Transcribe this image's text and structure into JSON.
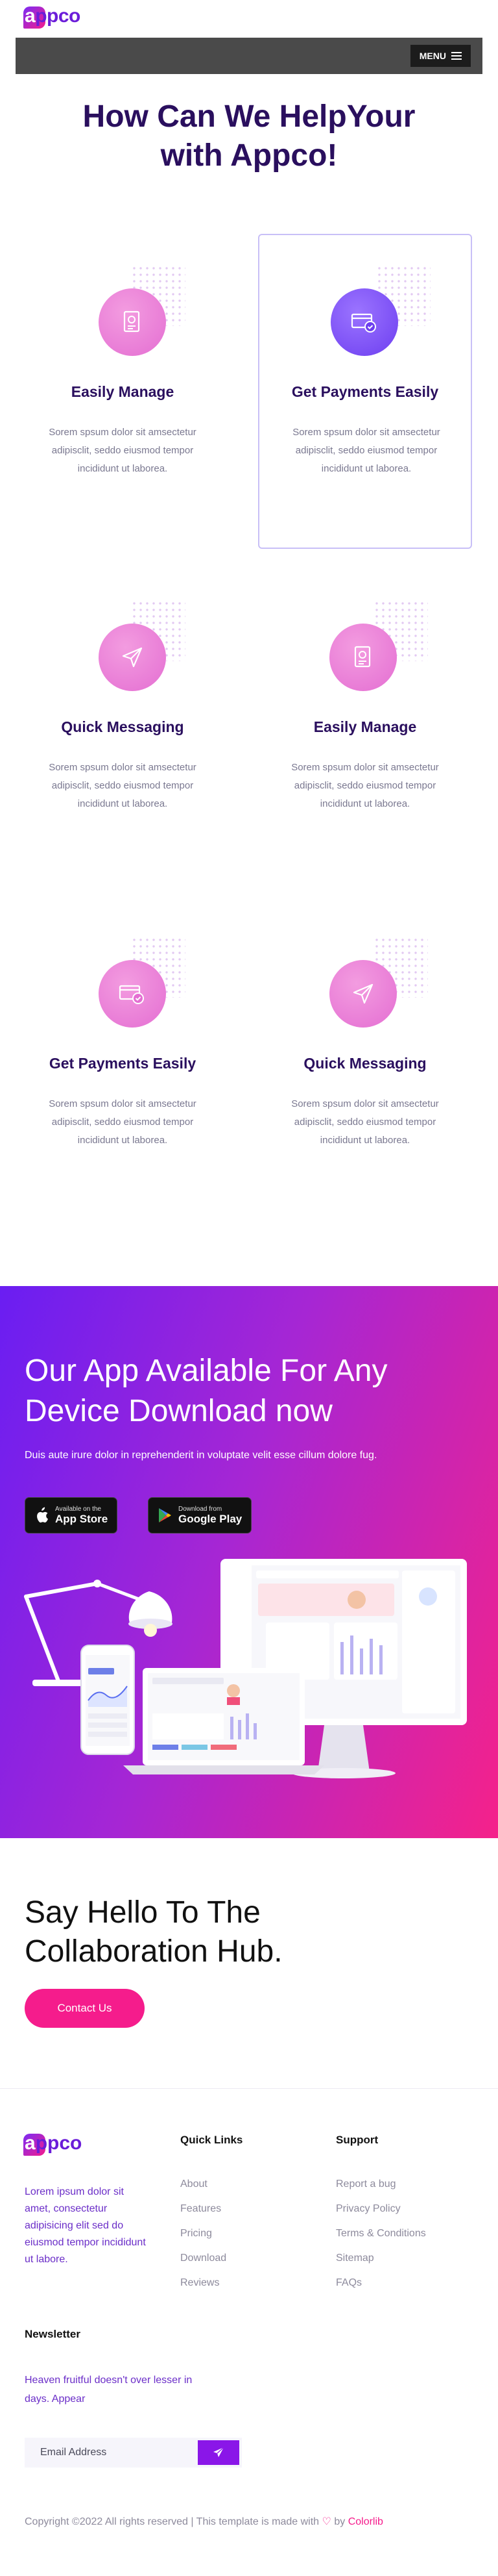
{
  "header": {
    "logo_first": "a",
    "logo_rest": "ppco",
    "menu_label": "MENU"
  },
  "help": {
    "title_line1": "How Can We HelpYour",
    "title_line2": "with Appco!"
  },
  "features": [
    {
      "title": "Easily Manage",
      "text": "Sorem spsum dolor sit amsectetur adipisclit, seddo eiusmod tempor incididunt ut laborea.",
      "icon": "manage-icon"
    },
    {
      "title": "Get Payments Easily",
      "text": "Sorem spsum dolor sit amsectetur adipisclit, seddo eiusmod tempor incididunt ut laborea.",
      "icon": "payment-icon"
    },
    {
      "title": "Quick Messaging",
      "text": "Sorem spsum dolor sit amsectetur adipisclit, seddo eiusmod tempor incididunt ut laborea.",
      "icon": "paper-plane-icon"
    },
    {
      "title": "Easily Manage",
      "text": "Sorem spsum dolor sit amsectetur adipisclit, seddo eiusmod tempor incididunt ut laborea.",
      "icon": "manage-icon"
    },
    {
      "title": "Get Payments Easily",
      "text": "Sorem spsum dolor sit amsectetur adipisclit, seddo eiusmod tempor incididunt ut laborea.",
      "icon": "payment-icon"
    },
    {
      "title": "Quick Messaging",
      "text": "Sorem spsum dolor sit amsectetur adipisclit, seddo eiusmod tempor incididunt ut laborea.",
      "icon": "paper-plane-icon"
    }
  ],
  "app": {
    "title_line1": "Our App Available For Any",
    "title_line2": "Device Download now",
    "subtitle": "Duis aute irure dolor in reprehenderit in voluptate velit esse cillum dolore fug.",
    "appstore_small": "Available on the",
    "appstore_big": "App Store",
    "gplay_small": "Download from",
    "gplay_big": "Google Play"
  },
  "collab": {
    "title_line1": "Say Hello To The",
    "title_line2": "Collaboration Hub.",
    "button": "Contact Us"
  },
  "footer": {
    "about": "Lorem ipsum dolor sit amet, consectetur adipisicing elit sed do eiusmod tempor incididunt ut labore.",
    "quick_links_title": "Quick Links",
    "quick_links": [
      "About",
      "Features",
      "Pricing",
      "Download",
      "Reviews"
    ],
    "support_title": "Support",
    "support_links": [
      "Report a bug",
      "Privacy Policy",
      "Terms & Conditions",
      "Sitemap",
      "FAQs"
    ],
    "newsletter_title": "Newsletter",
    "newsletter_text": "Heaven fruitful doesn't over lesser in days. Appear",
    "email_placeholder": "Email Address",
    "copyright_pre": "Copyright ©2022 All rights reserved | This template is made with",
    "copyright_by": "by",
    "copyright_brand": "Colorlib"
  },
  "colors": {
    "primary": "#2a0f5e",
    "accent_pink": "#f51c8c",
    "accent_purple": "#6d3ef0"
  }
}
